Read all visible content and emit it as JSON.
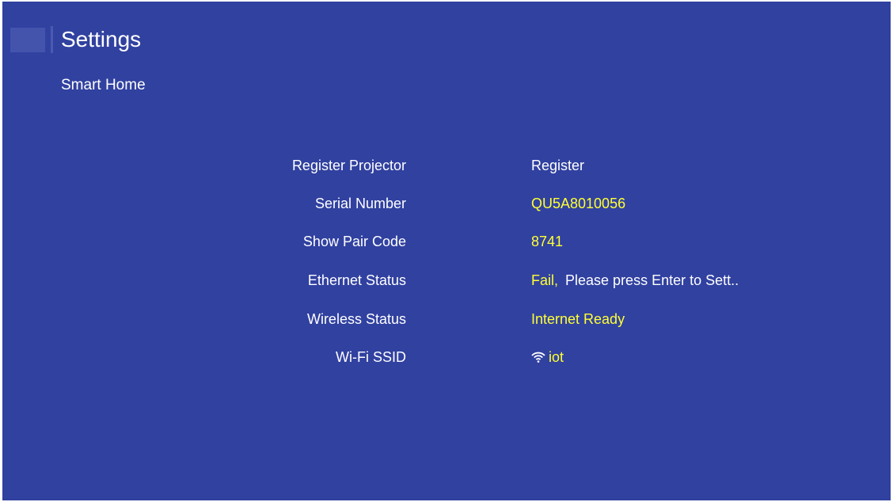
{
  "header": {
    "title": "Settings",
    "section": "Smart Home"
  },
  "colors": {
    "background": "#3141a0",
    "label_text": "#ffffff",
    "highlight_value": "#ffff33"
  },
  "rows": [
    {
      "label": "Register Projector",
      "value": "Register"
    },
    {
      "label": "Serial Number",
      "value": "QU5A8010056"
    },
    {
      "label": "Show Pair Code",
      "value": "8741"
    },
    {
      "label": "Ethernet Status",
      "status": "Fail,",
      "message": "Please press Enter to Sett.."
    },
    {
      "label": "Wireless Status",
      "value": "Internet Ready"
    },
    {
      "label": "Wi-Fi SSID",
      "icon": "wifi-icon",
      "value": "iot"
    }
  ]
}
